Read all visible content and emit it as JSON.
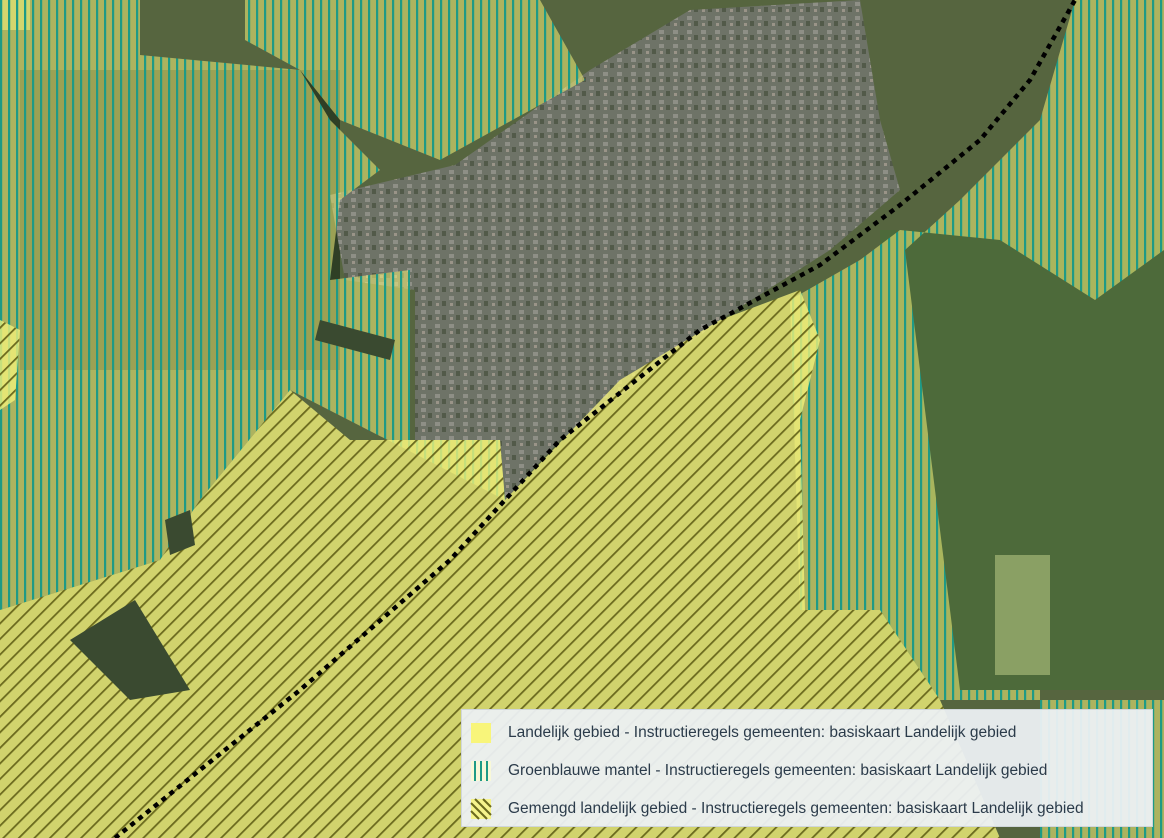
{
  "map": {
    "basemap": "aerial-photo",
    "colors": {
      "landelijk_fill": "#f4f27a",
      "groenblauw_stripe": "#1e9a86",
      "gemengd_stripe": "#6b6a1e",
      "boundary_line": "#000000"
    }
  },
  "legend": {
    "items": [
      {
        "icon": "yellow-fill-swatch",
        "label": "Landelijk gebied - Instructieregels gemeenten: basiskaart Landelijk gebied"
      },
      {
        "icon": "vertical-stripes-swatch",
        "label": "Groenblauwe mantel - Instructieregels gemeenten: basiskaart Landelijk gebied"
      },
      {
        "icon": "diagonal-stripes-swatch",
        "label": "Gemengd landelijk gebied - Instructieregels gemeenten: basiskaart Landelijk gebied"
      }
    ]
  }
}
